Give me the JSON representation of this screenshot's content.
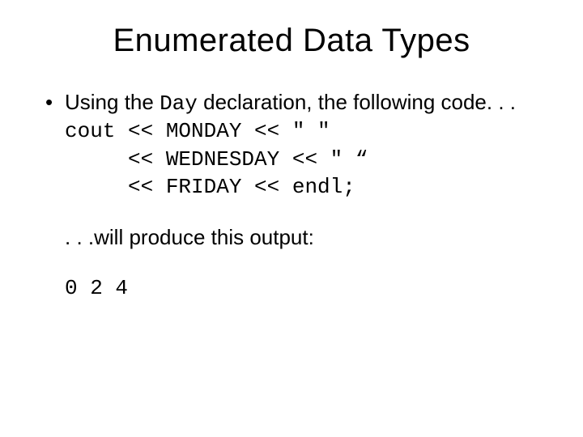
{
  "title": "Enumerated Data Types",
  "bullet": {
    "pre": "Using the ",
    "code_inline": "Day",
    "post": " declaration, the following code. . ."
  },
  "code": {
    "l1": "cout << MONDAY << \" \"",
    "l2": "     << WEDNESDAY << \" “",
    "l3": "     << FRIDAY << endl;"
  },
  "after": ". . .will produce this output:",
  "output": "0 2 4"
}
